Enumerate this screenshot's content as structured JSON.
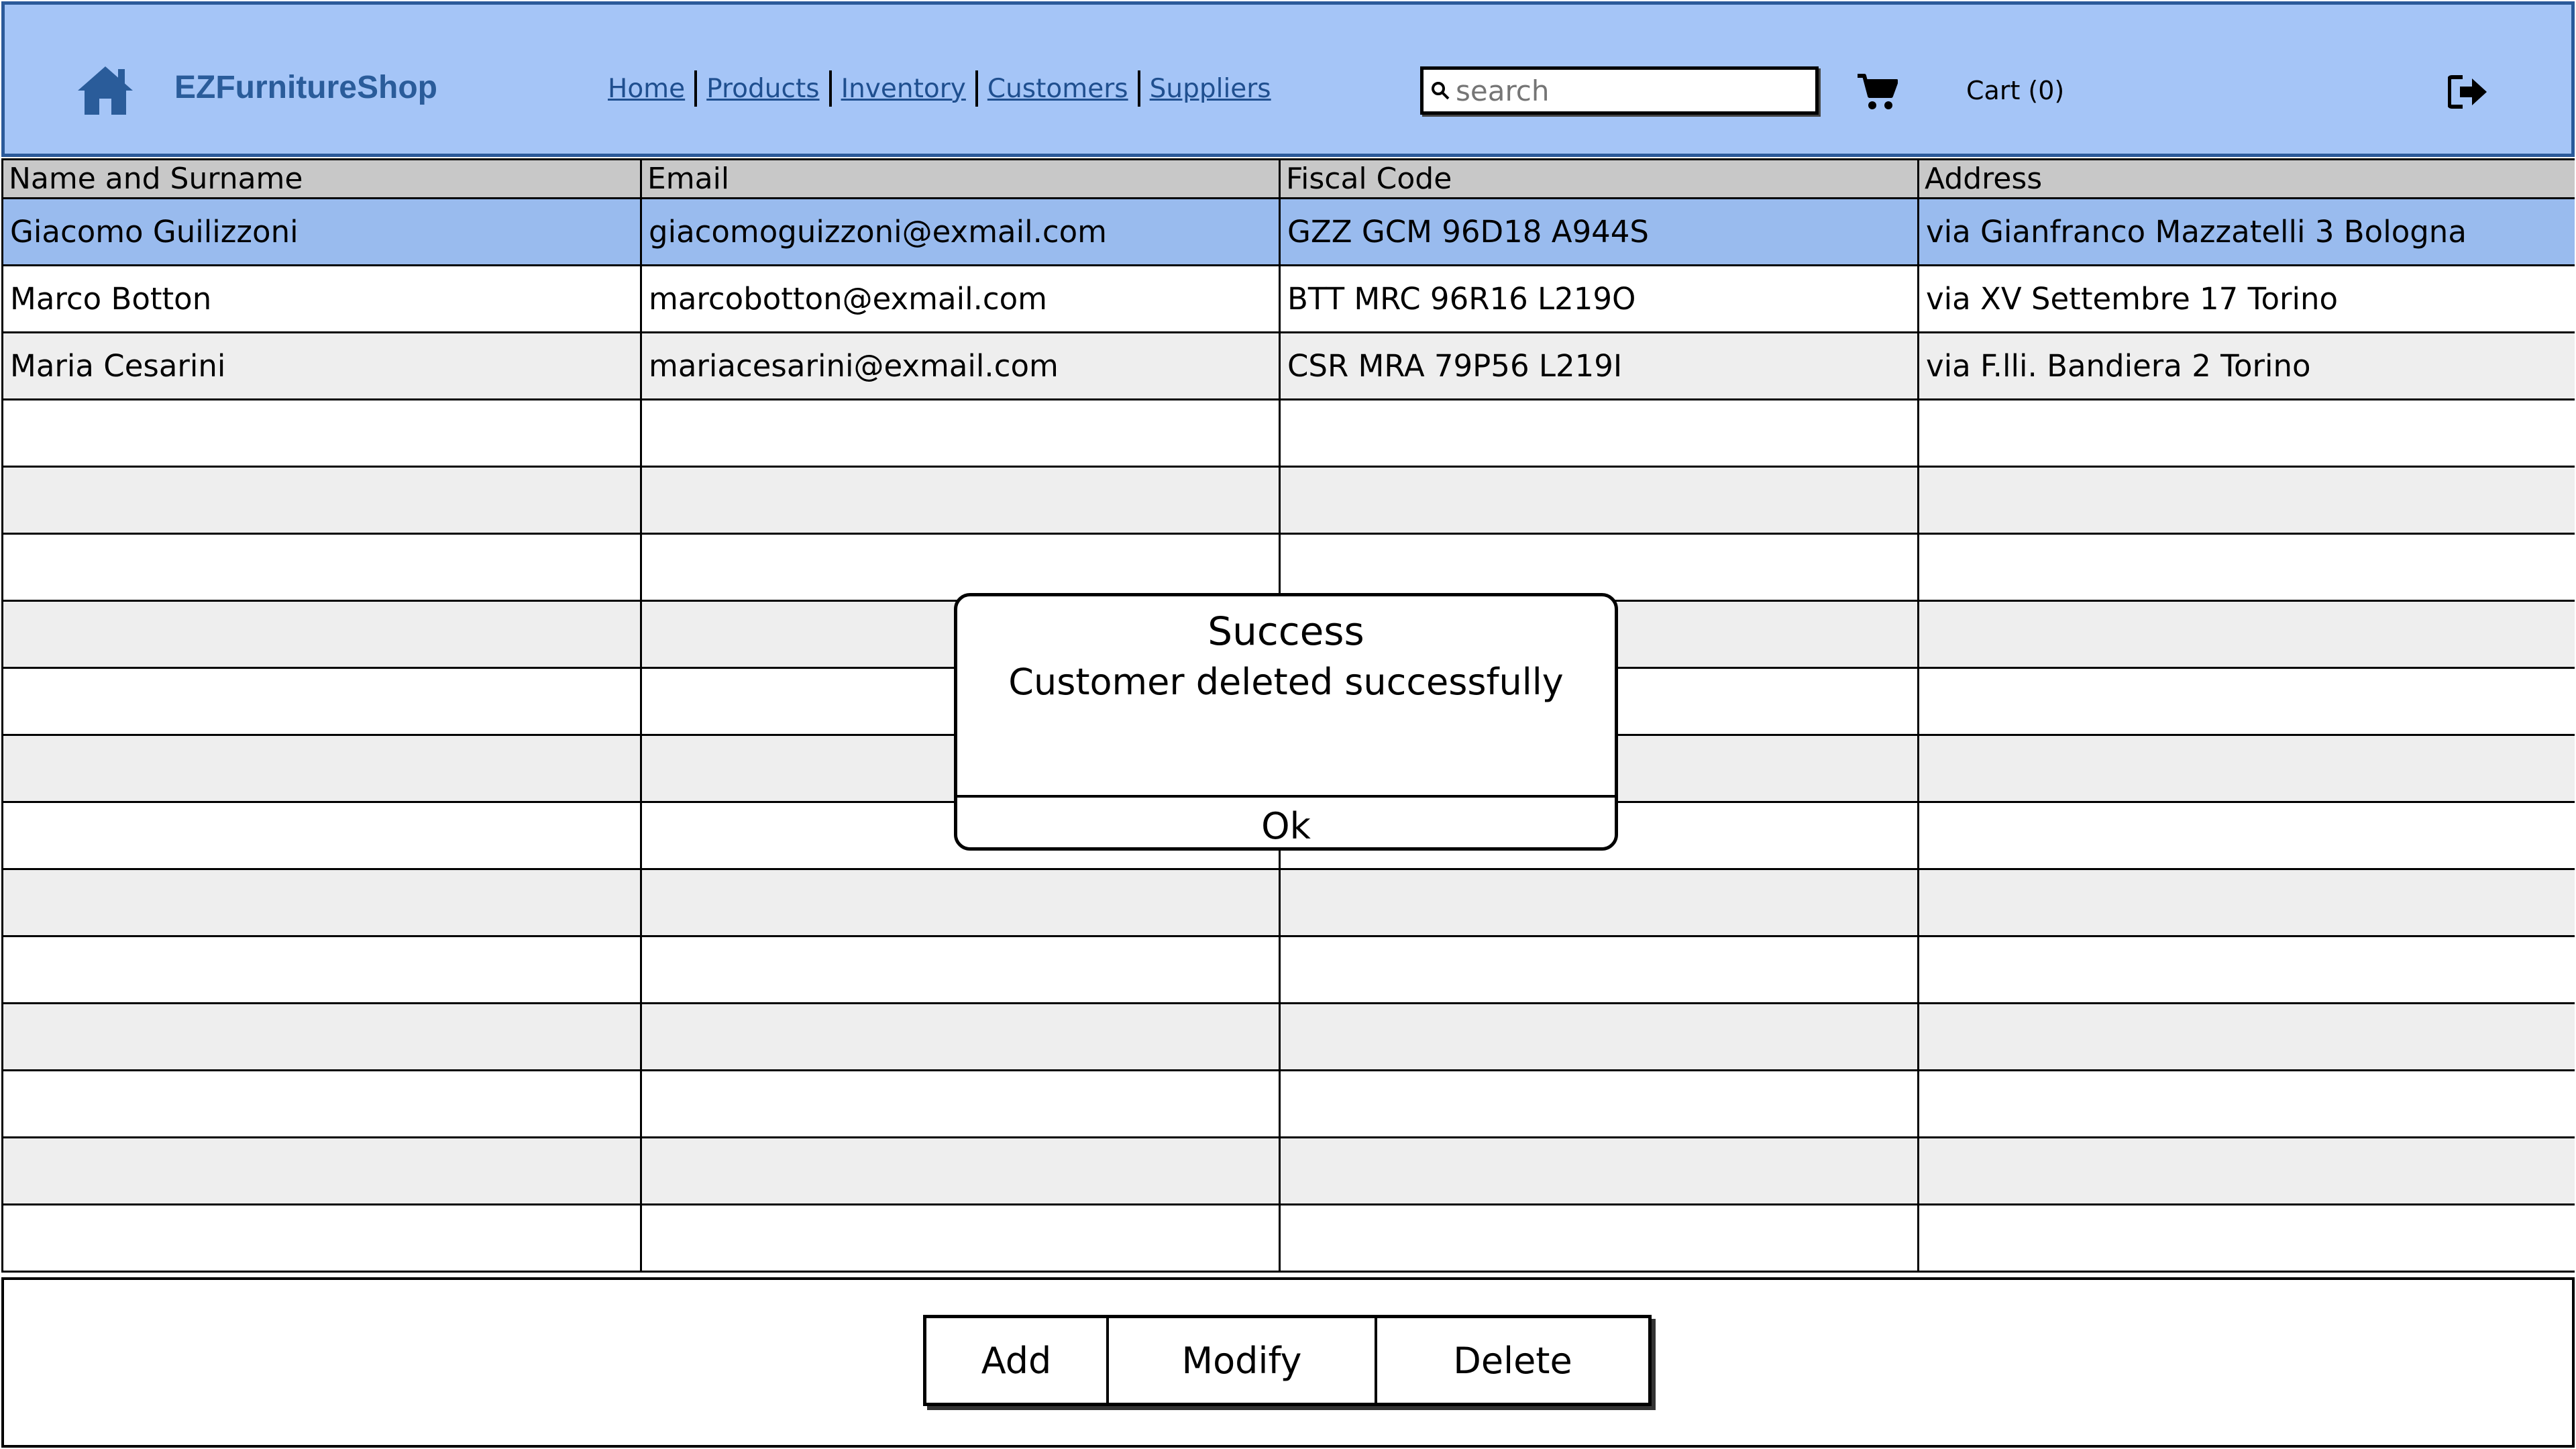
{
  "header": {
    "brand": "EZFurnitureShop",
    "nav": [
      "Home",
      "Products",
      "Inventory",
      "Customers",
      "Suppliers"
    ],
    "search_placeholder": "search",
    "cart_label": "Cart (0)",
    "accent_color": "#2a5c9a",
    "background_color": "#a5c5f7",
    "icons": [
      "home-icon",
      "search-icon",
      "cart-icon",
      "logout-icon"
    ]
  },
  "table": {
    "columns": [
      "Name and Surname",
      "Email",
      "Fiscal Code",
      "Address"
    ],
    "rows": [
      [
        "Giacomo Guilizzoni",
        "giacomoguizzoni@exmail.com",
        "GZZ GCM 96D18 A944S",
        "via Gianfranco Mazzatelli 3 Bologna"
      ],
      [
        "Marco Botton",
        "marcobotton@exmail.com",
        "BTT MRC 96R16 L219O",
        "via XV Settembre 17 Torino"
      ],
      [
        "Maria Cesarini",
        "mariacesarini@exmail.com",
        "CSR MRA 79P56 L219I",
        "via F.lli. Bandiera 2 Torino"
      ]
    ],
    "empty_row_count": 13,
    "selected_row": 0,
    "selected_color": "#99bbee"
  },
  "actions": {
    "add": "Add",
    "modify": "Modify",
    "delete": "Delete"
  },
  "dialog": {
    "title": "Success",
    "message": "Customer deleted successfully",
    "ok": "Ok"
  }
}
